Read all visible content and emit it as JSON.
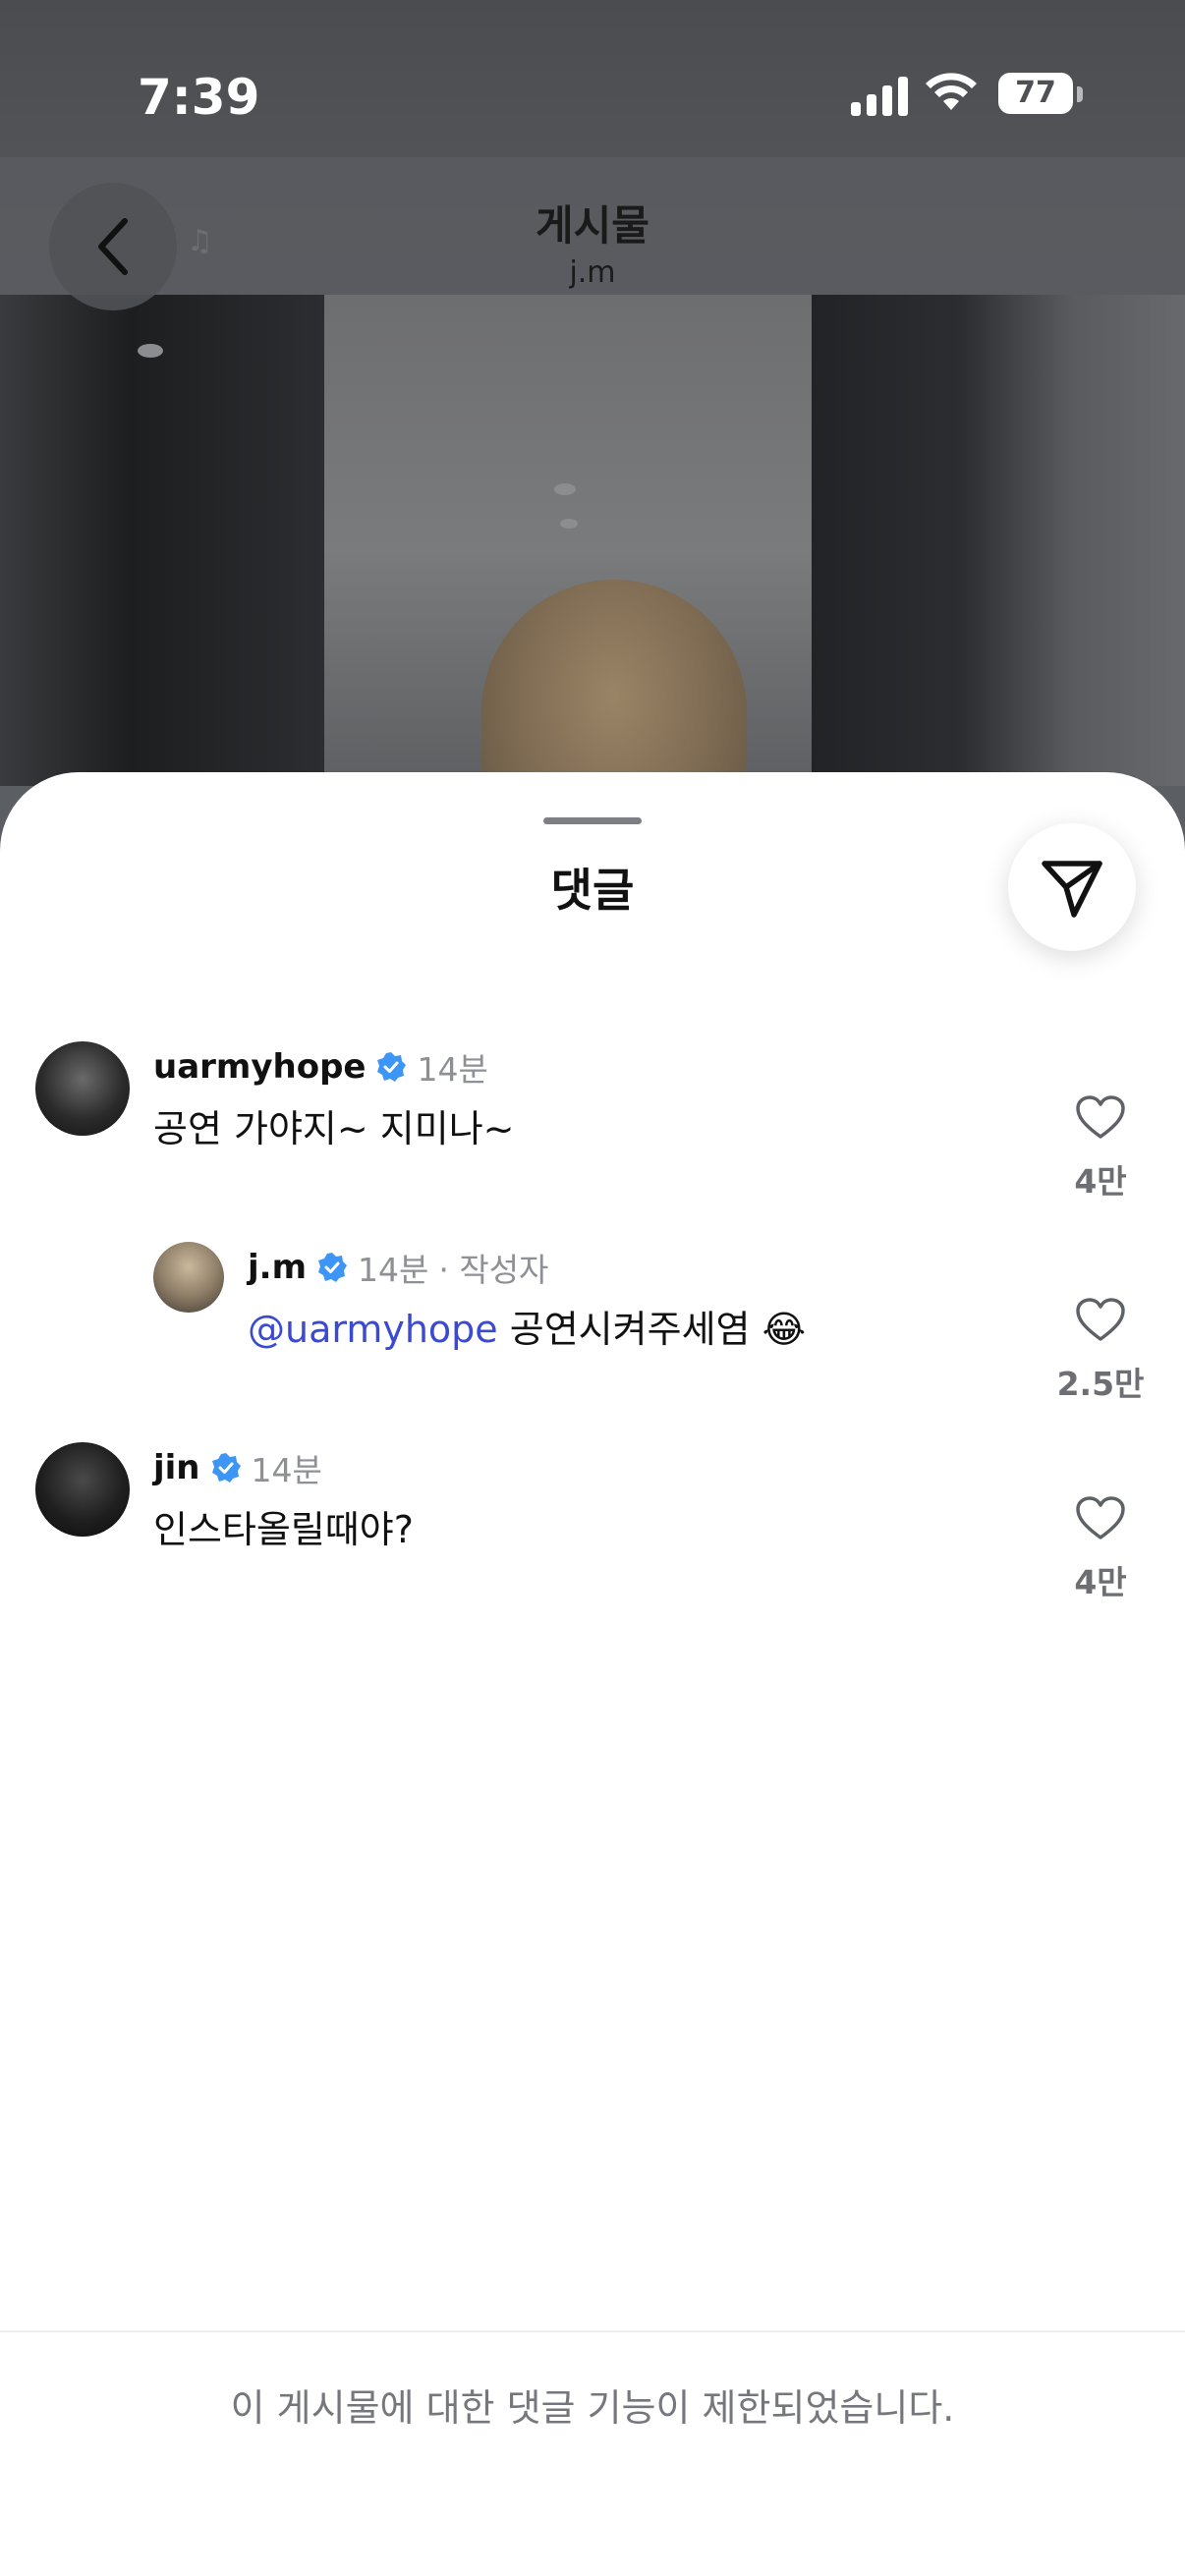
{
  "status_bar": {
    "time": "7:39",
    "battery": "77"
  },
  "post_header": {
    "title": "게시물",
    "subtitle": "j.m"
  },
  "sheet": {
    "title": "댓글"
  },
  "comments": [
    {
      "username": "uarmyhope",
      "time": "14분",
      "text": "공연 가야지~ 지미나~",
      "likes": "4만"
    },
    {
      "username": "j.m",
      "time": "14분",
      "author_tag": "· 작성자",
      "mention": "@uarmyhope",
      "text": "공연시켜주세염",
      "emoji": "😂",
      "likes": "2.5만"
    },
    {
      "username": "jin",
      "time": "14분",
      "text": "인스타올릴때야?",
      "likes": "4만"
    }
  ],
  "footer": {
    "notice": "이 게시물에 대한 댓글 기능이 제한되었습니다."
  },
  "colors": {
    "verified": "#3d96f5",
    "mention": "#3b4ad4",
    "sheet_bg": "#ffffff",
    "dim_bg": "#5b5e63"
  },
  "icons": [
    "back-chevron-icon",
    "send-icon",
    "verified-badge-icon",
    "heart-icon",
    "signal-icon",
    "wifi-icon"
  ]
}
